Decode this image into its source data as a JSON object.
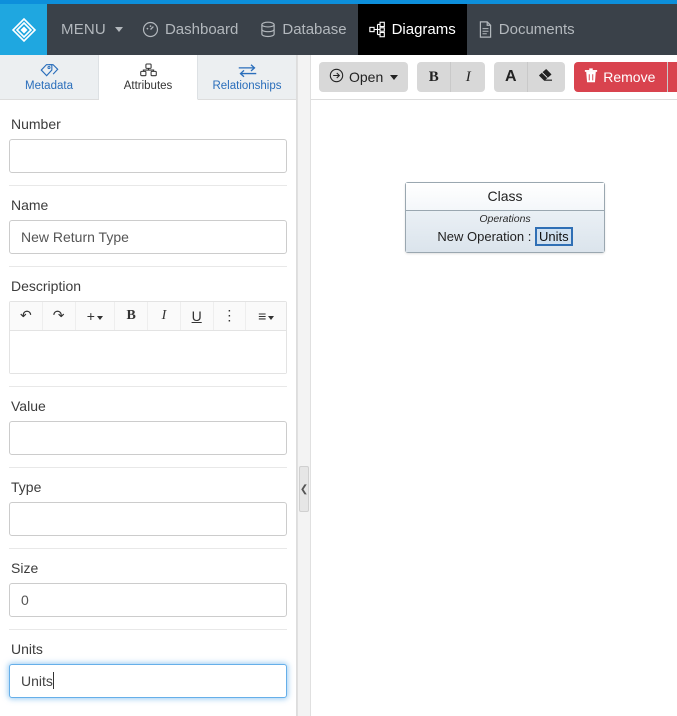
{
  "theme": {
    "accent_blue": "#0d8fdb",
    "navbar_bg": "#3a4149",
    "brand_bg": "#1fa7e0",
    "active_tab_bg": "#000000",
    "danger_red": "#d9434e",
    "link_blue": "#2a6ebb",
    "focus_blue": "#66afe9"
  },
  "navbar": {
    "brand_icon": "diamond-logo-icon",
    "items": [
      {
        "label": "MENU",
        "icon": "menu-caret-icon",
        "active": false
      },
      {
        "label": "Dashboard",
        "icon": "gauge-icon",
        "active": false
      },
      {
        "label": "Database",
        "icon": "database-icon",
        "active": false
      },
      {
        "label": "Diagrams",
        "icon": "diagram-nodes-icon",
        "active": true
      },
      {
        "label": "Documents",
        "icon": "document-icon",
        "active": false
      }
    ]
  },
  "left_panel": {
    "tabs": [
      {
        "label": "Metadata",
        "icon": "tag-icon",
        "active": false
      },
      {
        "label": "Attributes",
        "icon": "attributes-cubes-icon",
        "active": true
      },
      {
        "label": "Relationships",
        "icon": "exchange-arrows-icon",
        "active": false
      }
    ],
    "fields": {
      "number": {
        "label": "Number",
        "value": "",
        "placeholder": ""
      },
      "name": {
        "label": "Name",
        "value": "New Return Type",
        "placeholder": ""
      },
      "description": {
        "label": "Description",
        "value": ""
      },
      "value": {
        "label": "Value",
        "value": "",
        "placeholder": ""
      },
      "type": {
        "label": "Type",
        "value": "",
        "placeholder": ""
      },
      "size": {
        "label": "Size",
        "value": "0",
        "placeholder": ""
      },
      "units": {
        "label": "Units",
        "value": "Units",
        "placeholder": "",
        "focused": true
      }
    },
    "description_toolbar": [
      {
        "icon": "undo-icon",
        "label": "↶"
      },
      {
        "icon": "redo-icon",
        "label": "↷"
      },
      {
        "icon": "insert-plus-icon",
        "label": "+"
      },
      {
        "icon": "bold-icon",
        "label": "B"
      },
      {
        "icon": "italic-icon",
        "label": "I"
      },
      {
        "icon": "underline-icon",
        "label": "U"
      },
      {
        "icon": "more-vertical-icon",
        "label": "⋮"
      },
      {
        "icon": "align-left-icon",
        "label": "≡"
      }
    ]
  },
  "splitter": {
    "handle_icon": "chevron-left-icon",
    "handle_label": "❮"
  },
  "toolbar": {
    "open_label": "Open",
    "open_icon": "open-arrow-circle-icon",
    "bold_label": "B",
    "italic_label": "I",
    "font_color_label": "A",
    "eraser_icon": "eraser-icon",
    "remove_label": "Remove",
    "remove_icon": "trash-icon",
    "remove_caret_icon": "caret-down-icon"
  },
  "diagram": {
    "class_box": {
      "title": "Class",
      "section_title": "Operations",
      "operation_name": "New Operation : ",
      "selected_token": "Units"
    }
  }
}
